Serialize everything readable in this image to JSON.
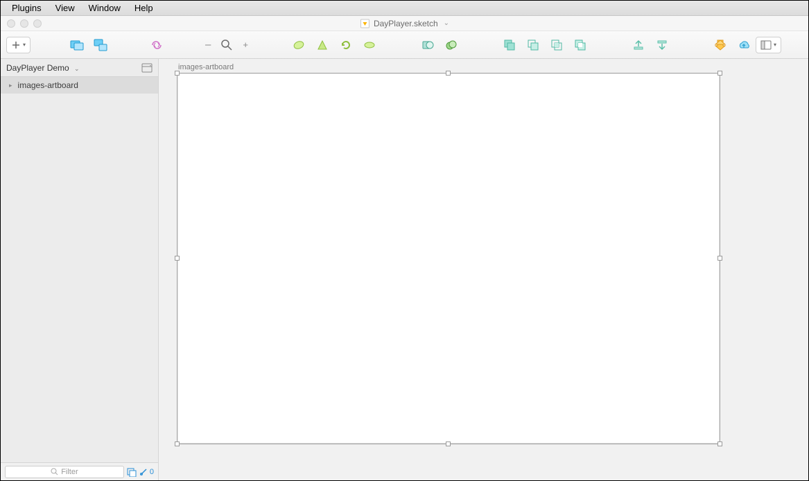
{
  "menubar": {
    "items": [
      "Plugins",
      "View",
      "Window",
      "Help"
    ]
  },
  "window": {
    "title": "DayPlayer.sketch"
  },
  "toolbar": {
    "zoom_minus": "–",
    "zoom_plus": "+"
  },
  "sidebar": {
    "page_name": "DayPlayer Demo",
    "layers": [
      {
        "name": "images-artboard"
      }
    ],
    "filter_placeholder": "Filter",
    "mirror_count": "0"
  },
  "canvas": {
    "artboard_label": "images-artboard"
  }
}
